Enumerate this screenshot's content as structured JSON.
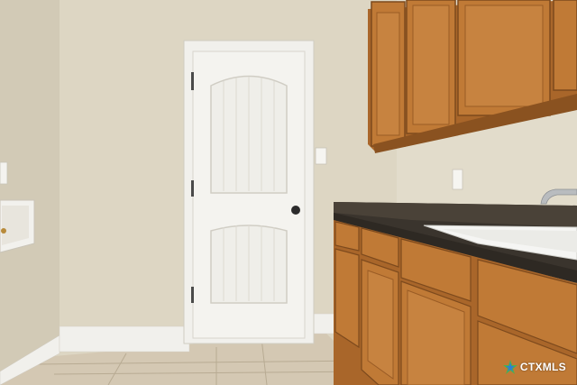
{
  "scene": {
    "description_type": "photo",
    "colors": {
      "wall": "#ddd6c3",
      "wall_left": "#d2cab6",
      "door": "#f4f3ef",
      "trim": "#f1f0ec",
      "cabinet_wood": "#c07a36",
      "cabinet_dark": "#8a5220",
      "countertop": "#3a342d",
      "floor_tile": "#d4c8b3",
      "sink": "#f5f5f3"
    }
  },
  "watermark": {
    "brand": "CTXMLS",
    "icon": "ctxmls-star-icon"
  }
}
